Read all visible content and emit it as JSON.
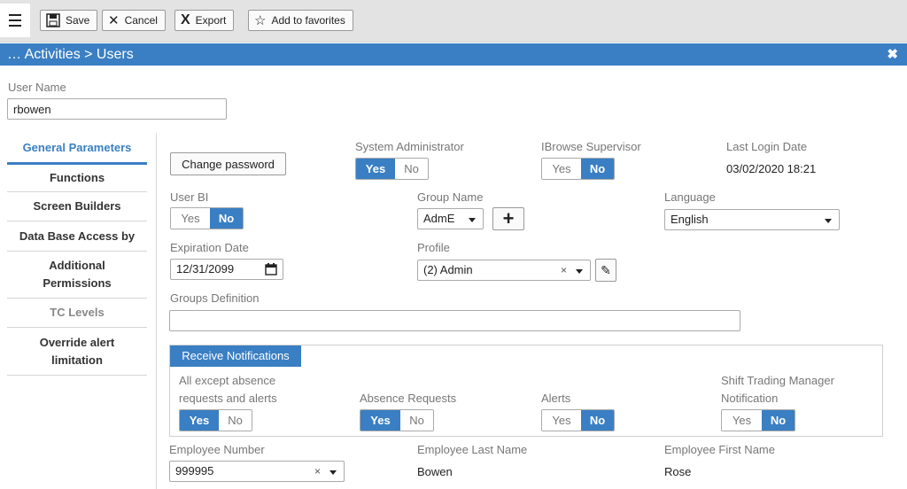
{
  "toolbar": {
    "save_label": "Save",
    "cancel_label": "Cancel",
    "export_label": "Export",
    "favorites_label": "Add to favorites"
  },
  "header": {
    "breadcrumb": "… Activities > Users",
    "close": "✖"
  },
  "user": {
    "label": "User Name",
    "value": "rbowen"
  },
  "sidebar": {
    "items": [
      {
        "label": "General Parameters"
      },
      {
        "label": "Functions"
      },
      {
        "label": "Screen Builders"
      },
      {
        "label": "Data Base Access by"
      },
      {
        "label": "Additional Permissions"
      },
      {
        "label": "TC Levels"
      },
      {
        "label": "Override alert limitation"
      }
    ]
  },
  "form": {
    "change_password": "Change password",
    "system_admin": {
      "label": "System Administrator",
      "yes": "Yes",
      "no": "No",
      "selected": "Yes"
    },
    "ibrowse_supervisor": {
      "label": "IBrowse Supervisor",
      "yes": "Yes",
      "no": "No",
      "selected": "No"
    },
    "last_login": {
      "label": "Last Login Date",
      "value": "03/02/2020 18:21"
    },
    "user_bi": {
      "label": "User BI",
      "yes": "Yes",
      "no": "No",
      "selected": "No"
    },
    "group_name": {
      "label": "Group Name",
      "value": "AdmE"
    },
    "language": {
      "label": "Language",
      "value": "English"
    },
    "expiration": {
      "label": "Expiration Date",
      "value": "12/31/2099"
    },
    "profile": {
      "label": "Profile",
      "value": "(2) Admin"
    },
    "groups_definition": {
      "label": "Groups Definition",
      "value": ""
    }
  },
  "notifications": {
    "title": "Receive Notifications",
    "all_except": {
      "label_line1": "All except absence",
      "label_line2": "requests and alerts",
      "yes": "Yes",
      "no": "No",
      "selected": "Yes"
    },
    "absence_requests": {
      "label": "Absence Requests",
      "yes": "Yes",
      "no": "No",
      "selected": "Yes"
    },
    "alerts": {
      "label": "Alerts",
      "yes": "Yes",
      "no": "No",
      "selected": "No"
    },
    "shift_trading": {
      "label_line1": "Shift Trading Manager",
      "label_line2": "Notification",
      "yes": "Yes",
      "no": "No",
      "selected": "No"
    }
  },
  "employee": {
    "number": {
      "label": "Employee Number",
      "value": "999995"
    },
    "last_name": {
      "label": "Employee Last Name",
      "value": "Bowen"
    },
    "first_name": {
      "label": "Employee First Name",
      "value": "Rose"
    }
  },
  "colors": {
    "accent": "#3a7fc3",
    "toolbar_bg": "#e3e3e3"
  }
}
